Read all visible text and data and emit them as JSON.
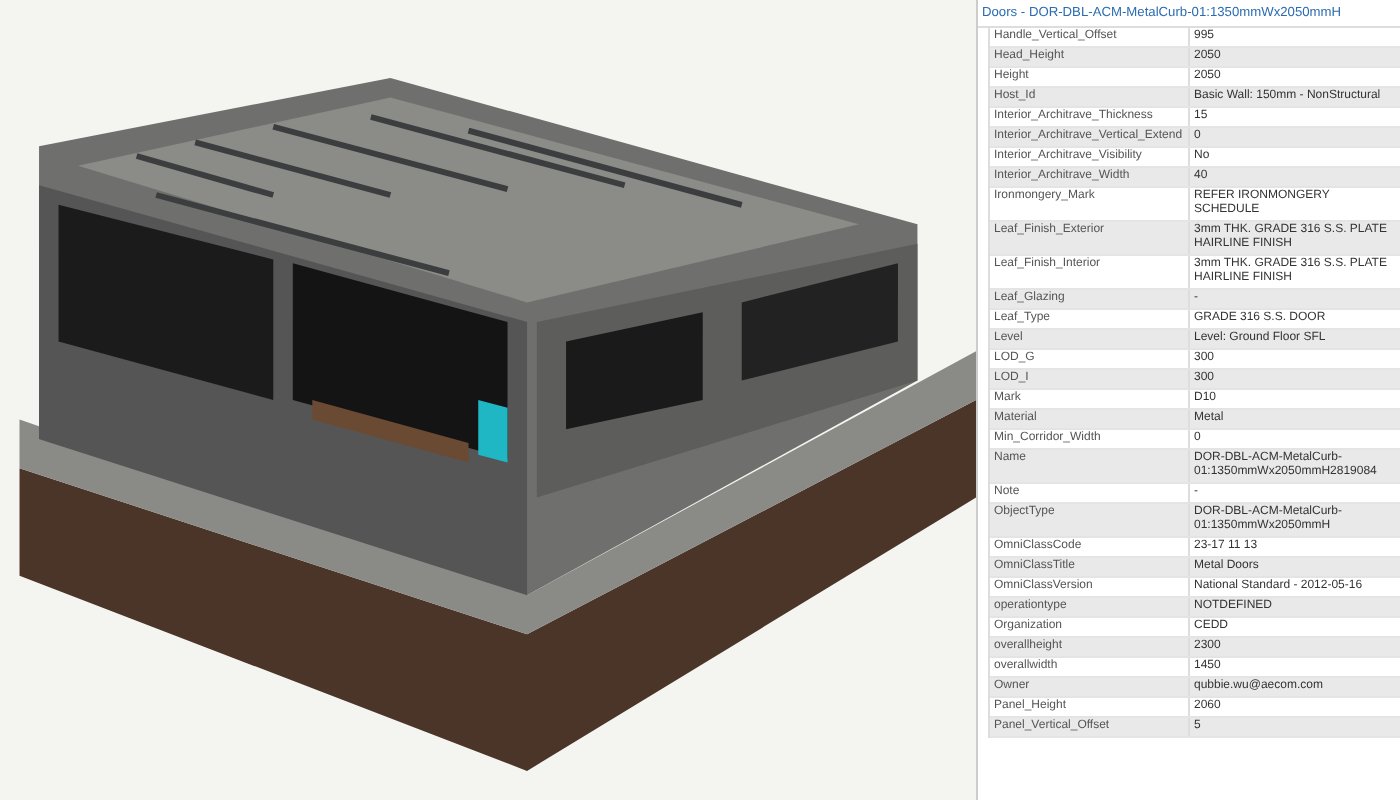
{
  "panel": {
    "title": "Doors - DOR-DBL-ACM-MetalCurb-01:1350mmWx2050mmH",
    "rows": [
      {
        "label": "Handle_Vertical_Offset",
        "value": "995"
      },
      {
        "label": "Head_Height",
        "value": "2050"
      },
      {
        "label": "Height",
        "value": "2050"
      },
      {
        "label": "Host_Id",
        "value": "Basic Wall: 150mm - NonStructural"
      },
      {
        "label": "Interior_Architrave_Thickness",
        "value": "15"
      },
      {
        "label": "Interior_Architrave_Vertical_Extend",
        "value": "0"
      },
      {
        "label": "Interior_Architrave_Visibility",
        "value": "No"
      },
      {
        "label": "Interior_Architrave_Width",
        "value": "40"
      },
      {
        "label": "Ironmongery_Mark",
        "value": "REFER IRONMONGERY SCHEDULE"
      },
      {
        "label": "Leaf_Finish_Exterior",
        "value": "3mm THK. GRADE 316 S.S. PLATE HAIRLINE FINISH"
      },
      {
        "label": "Leaf_Finish_Interior",
        "value": "3mm THK. GRADE 316 S.S. PLATE HAIRLINE FINISH"
      },
      {
        "label": "Leaf_Glazing",
        "value": "-"
      },
      {
        "label": "Leaf_Type",
        "value": "GRADE 316 S.S. DOOR"
      },
      {
        "label": "Level",
        "value": "Level: Ground Floor SFL"
      },
      {
        "label": "LOD_G",
        "value": "300"
      },
      {
        "label": "LOD_I",
        "value": "300"
      },
      {
        "label": "Mark",
        "value": "D10"
      },
      {
        "label": "Material",
        "value": "Metal"
      },
      {
        "label": "Min_Corridor_Width",
        "value": "0"
      },
      {
        "label": "Name",
        "value": "DOR-DBL-ACM-MetalCurb-01:1350mmWx2050mmH2819084"
      },
      {
        "label": "Note",
        "value": "-"
      },
      {
        "label": "ObjectType",
        "value": "DOR-DBL-ACM-MetalCurb-01:1350mmWx2050mmH"
      },
      {
        "label": "OmniClassCode",
        "value": "23-17 11 13"
      },
      {
        "label": "OmniClassTitle",
        "value": "Metal Doors"
      },
      {
        "label": "OmniClassVersion",
        "value": "National Standard - 2012-05-16"
      },
      {
        "label": "operationtype",
        "value": "NOTDEFINED"
      },
      {
        "label": "Organization",
        "value": "CEDD"
      },
      {
        "label": "overallheight",
        "value": "2300"
      },
      {
        "label": "overallwidth",
        "value": "1450"
      },
      {
        "label": "Owner",
        "value": "qubbie.wu@aecom.com"
      },
      {
        "label": "Panel_Height",
        "value": "2060"
      },
      {
        "label": "Panel_Vertical_Offset",
        "value": "5"
      }
    ]
  }
}
